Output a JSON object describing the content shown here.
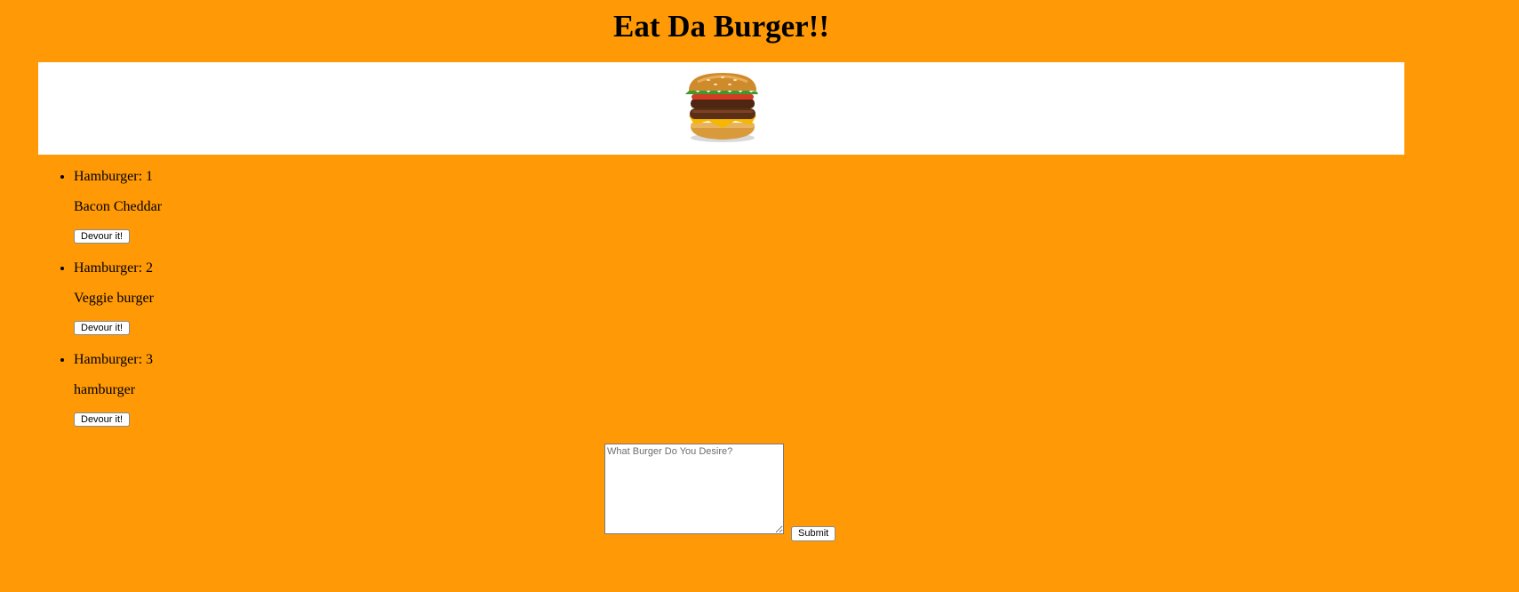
{
  "page": {
    "title": "Eat Da Burger!!"
  },
  "burgers": [
    {
      "label": "Hamburger: 1",
      "name": "Bacon Cheddar",
      "button": "Devour it!"
    },
    {
      "label": "Hamburger: 2",
      "name": "Veggie burger",
      "button": "Devour it!"
    },
    {
      "label": "Hamburger: 3",
      "name": "hamburger",
      "button": "Devour it!"
    }
  ],
  "form": {
    "placeholder": "What Burger Do You Desire?",
    "value": "",
    "submit_label": "Submit"
  },
  "colors": {
    "background": "#FF9905",
    "banner": "#FFFFFF"
  }
}
